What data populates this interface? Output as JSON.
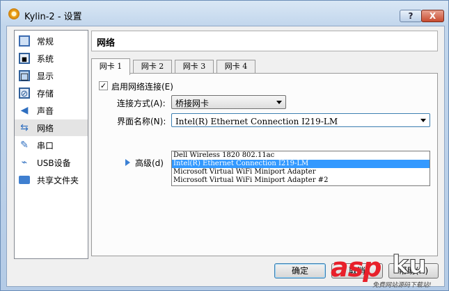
{
  "window": {
    "title": "Kylin-2 - 设置",
    "help_label": "?",
    "close_label": "X"
  },
  "sidebar": {
    "items": [
      {
        "label": "常规",
        "icon": "general-icon"
      },
      {
        "label": "系统",
        "icon": "system-icon"
      },
      {
        "label": "显示",
        "icon": "display-icon"
      },
      {
        "label": "存储",
        "icon": "storage-icon"
      },
      {
        "label": "声音",
        "icon": "audio-icon"
      },
      {
        "label": "网络",
        "icon": "network-icon",
        "selected": true
      },
      {
        "label": "串口",
        "icon": "serial-icon"
      },
      {
        "label": "USB设备",
        "icon": "usb-icon"
      },
      {
        "label": "共享文件夹",
        "icon": "shared-folder-icon"
      }
    ]
  },
  "page": {
    "title": "网络"
  },
  "tabs": [
    {
      "label": "网卡 1",
      "active": true
    },
    {
      "label": "网卡 2"
    },
    {
      "label": "网卡 3"
    },
    {
      "label": "网卡 4"
    }
  ],
  "adapter": {
    "enable_label": "启用网络连接(E)",
    "enable_checked": true,
    "attached_label": "连接方式(A):",
    "attached_value": "桥接网卡",
    "name_label": "界面名称(N):",
    "name_value": "Intel(R) Ethernet Connection I219-LM",
    "options": [
      "Dell Wireless 1820 802.11ac",
      "Intel(R) Ethernet Connection I219-LM",
      "Microsoft Virtual WiFi Miniport Adapter",
      "Microsoft Virtual WiFi Miniport Adapter #2"
    ],
    "selected_option_index": 1,
    "advanced_label": "高级(d)"
  },
  "buttons": {
    "ok": "确定",
    "cancel": "取消",
    "help": "帮助(H)"
  },
  "watermark": {
    "brand_a": "asp",
    "brand_b": "ku",
    "subtitle": "免费网站源码下载站!"
  },
  "colors": {
    "selection": "#3399ff",
    "watermark_red": "#e8202a"
  }
}
